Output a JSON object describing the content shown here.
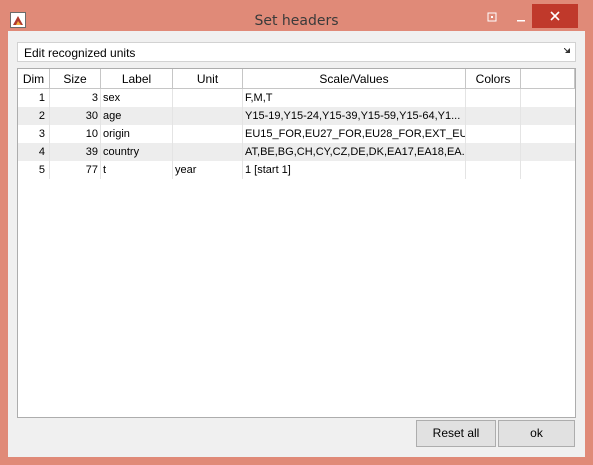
{
  "window": {
    "title": "Set headers",
    "icon": "matlab-figure-icon",
    "controls": [
      "help-icon",
      "minimize-icon",
      "close-icon"
    ]
  },
  "dropdown": {
    "selected": "Edit recognized units"
  },
  "table": {
    "headers": [
      "Dim",
      "Size",
      "Label",
      "Unit",
      "Scale/Values",
      "Colors",
      ""
    ],
    "rows": [
      {
        "dim": "1",
        "size": "3",
        "label": "sex",
        "unit": "",
        "values": "F,M,T",
        "colors": ""
      },
      {
        "dim": "2",
        "size": "30",
        "label": "age",
        "unit": "",
        "values": "Y15-19,Y15-24,Y15-39,Y15-59,Y15-64,Y1...",
        "colors": ""
      },
      {
        "dim": "3",
        "size": "10",
        "label": "origin",
        "unit": "",
        "values": "EU15_FOR,EU27_FOR,EU28_FOR,EXT_EU1...",
        "colors": ""
      },
      {
        "dim": "4",
        "size": "39",
        "label": "country",
        "unit": "",
        "values": "AT,BE,BG,CH,CY,CZ,DE,DK,EA17,EA18,EA...",
        "colors": ""
      },
      {
        "dim": "5",
        "size": "77",
        "label": "t",
        "unit": "year",
        "values": "1 [start 1]",
        "colors": ""
      }
    ]
  },
  "buttons": {
    "reset_all": "Reset all",
    "ok": "ok"
  },
  "colors": {
    "window_frame": "#e08a78",
    "close_button": "#c0392b",
    "row_alt": "#ededed"
  }
}
